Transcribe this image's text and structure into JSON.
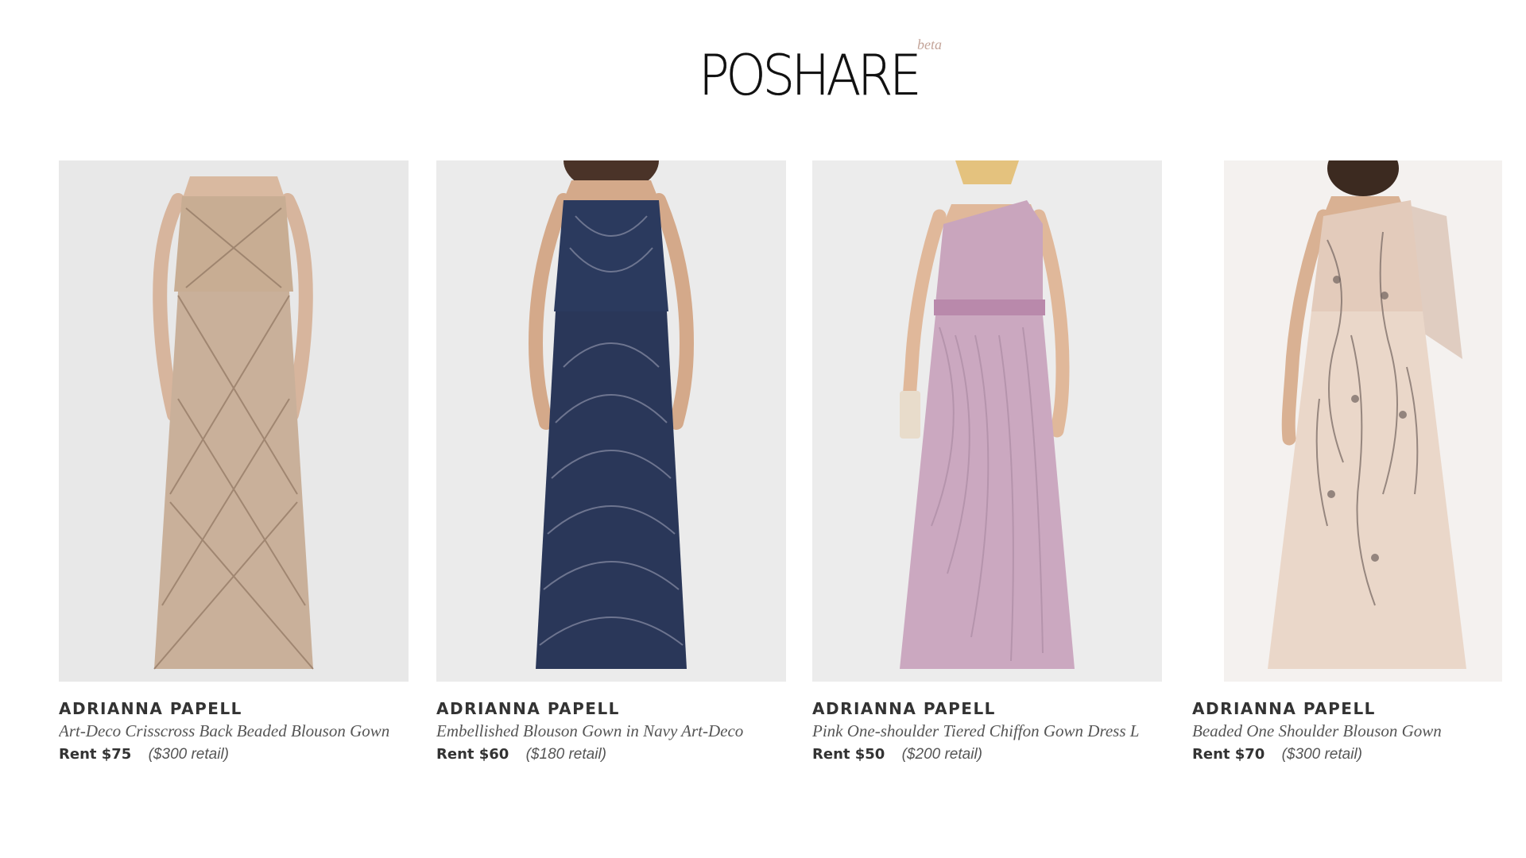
{
  "logo": {
    "text": "POSHARE",
    "badge": "beta"
  },
  "products": [
    {
      "brand": "ADRIANNA PAPELL",
      "name": "Art-Deco Crisscross Back Beaded Blouson Gown",
      "rent": "Rent $75",
      "retail": "($300 retail)",
      "image_icon": "beige-beaded-gown-image",
      "background_color": "#e8e8e8",
      "dress_color": "#c8ad93"
    },
    {
      "brand": "ADRIANNA PAPELL",
      "name": "Embellished Blouson Gown in Navy Art-Deco",
      "rent": "Rent $60",
      "retail": "($180 retail)",
      "image_icon": "navy-beaded-gown-image",
      "background_color": "#ebebeb",
      "dress_color": "#2b3a5e"
    },
    {
      "brand": "ADRIANNA PAPELL",
      "name": "Pink One-shoulder Tiered Chiffon Gown Dress L",
      "rent": "Rent $50",
      "retail": "($200 retail)",
      "image_icon": "pink-chiffon-gown-image",
      "background_color": "#ececec",
      "dress_color": "#c9a5bd"
    },
    {
      "brand": "ADRIANNA PAPELL",
      "name": "Beaded One Shoulder Blouson Gown",
      "rent": "Rent $70",
      "retail": "($300 retail)",
      "image_icon": "blush-beaded-gown-image",
      "background_color": "#ffffff",
      "dress_color": "#e8d3c4"
    }
  ]
}
